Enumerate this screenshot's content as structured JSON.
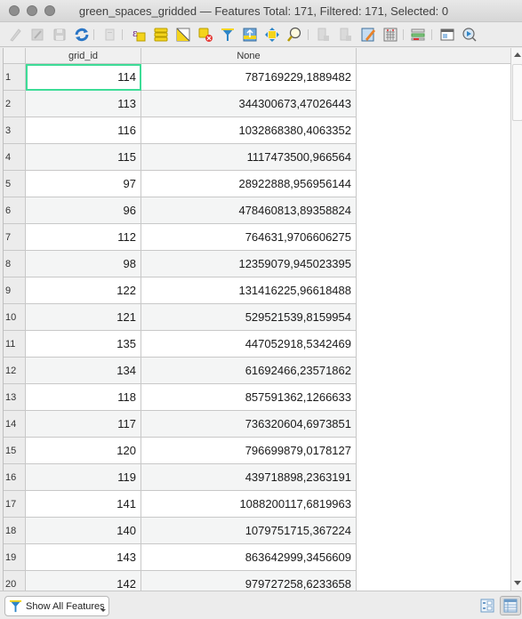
{
  "window": {
    "title": "green_spaces_gridded — Features Total: 171, Filtered: 171, Selected: 0"
  },
  "toolbar": {
    "buttons": [
      {
        "name": "toggle-editing",
        "icon": "pencil-icon",
        "enabled": false
      },
      {
        "name": "toggle-multi-edit",
        "icon": "multi-edit-icon",
        "enabled": false
      },
      {
        "name": "save-edits",
        "icon": "save-icon",
        "enabled": false
      },
      {
        "name": "reload-table",
        "icon": "refresh-icon",
        "enabled": true
      },
      {
        "name": "add-feature",
        "icon": "add-feature-icon",
        "enabled": false
      },
      {
        "name": "select-by-expression",
        "icon": "expression-select-icon",
        "enabled": true
      },
      {
        "name": "select-all",
        "icon": "select-all-icon",
        "enabled": true
      },
      {
        "name": "invert-selection",
        "icon": "invert-selection-icon",
        "enabled": true
      },
      {
        "name": "deselect-all",
        "icon": "deselect-icon",
        "enabled": true
      },
      {
        "name": "filter-select",
        "icon": "filter-icon",
        "enabled": true
      },
      {
        "name": "move-selection-top",
        "icon": "move-top-icon",
        "enabled": true
      },
      {
        "name": "pan-to-selected",
        "icon": "pan-icon",
        "enabled": true
      },
      {
        "name": "zoom-to-selected",
        "icon": "zoom-icon",
        "enabled": true
      },
      {
        "name": "copy-rows",
        "icon": "copy-icon",
        "enabled": false
      },
      {
        "name": "paste-features",
        "icon": "paste-icon",
        "enabled": false
      },
      {
        "name": "new-field",
        "icon": "new-field-icon",
        "enabled": true
      },
      {
        "name": "field-calculator",
        "icon": "calculator-icon",
        "enabled": true
      },
      {
        "name": "conditional-formatting",
        "icon": "conditional-format-icon",
        "enabled": true
      },
      {
        "name": "dock-window",
        "icon": "dock-icon",
        "enabled": true
      },
      {
        "name": "actions",
        "icon": "actions-icon",
        "enabled": true
      }
    ]
  },
  "table": {
    "columns": [
      "grid_id",
      "None"
    ],
    "rows": [
      {
        "n": "1",
        "grid_id": "114",
        "value": "787169229,1889482"
      },
      {
        "n": "2",
        "grid_id": "113",
        "value": "344300673,47026443"
      },
      {
        "n": "3",
        "grid_id": "116",
        "value": "1032868380,4063352"
      },
      {
        "n": "4",
        "grid_id": "115",
        "value": "1117473500,966564"
      },
      {
        "n": "5",
        "grid_id": "97",
        "value": "28922888,956956144"
      },
      {
        "n": "6",
        "grid_id": "96",
        "value": "478460813,89358824"
      },
      {
        "n": "7",
        "grid_id": "112",
        "value": "764631,9706606275"
      },
      {
        "n": "8",
        "grid_id": "98",
        "value": "12359079,945023395"
      },
      {
        "n": "9",
        "grid_id": "122",
        "value": "131416225,96618488"
      },
      {
        "n": "10",
        "grid_id": "121",
        "value": "529521539,8159954"
      },
      {
        "n": "11",
        "grid_id": "135",
        "value": "447052918,5342469"
      },
      {
        "n": "12",
        "grid_id": "134",
        "value": "61692466,23571862"
      },
      {
        "n": "13",
        "grid_id": "118",
        "value": "857591362,1266633"
      },
      {
        "n": "14",
        "grid_id": "117",
        "value": "736320604,6973851"
      },
      {
        "n": "15",
        "grid_id": "120",
        "value": "796699879,0178127"
      },
      {
        "n": "16",
        "grid_id": "119",
        "value": "439718898,2363191"
      },
      {
        "n": "17",
        "grid_id": "141",
        "value": "1088200117,6819963"
      },
      {
        "n": "18",
        "grid_id": "140",
        "value": "1079751715,367224"
      },
      {
        "n": "19",
        "grid_id": "143",
        "value": "863642999,3456609"
      },
      {
        "n": "20",
        "grid_id": "142",
        "value": "979727258,6233658"
      }
    ],
    "selected_cell": {
      "row": 1,
      "column": "grid_id"
    }
  },
  "statusbar": {
    "filter_label": "Show All Features",
    "view_modes": [
      "form-view",
      "table-view"
    ],
    "active_view": "table-view"
  },
  "colors": {
    "selection_outline": "#3ddc97",
    "alt_row": "#f4f5f5"
  }
}
